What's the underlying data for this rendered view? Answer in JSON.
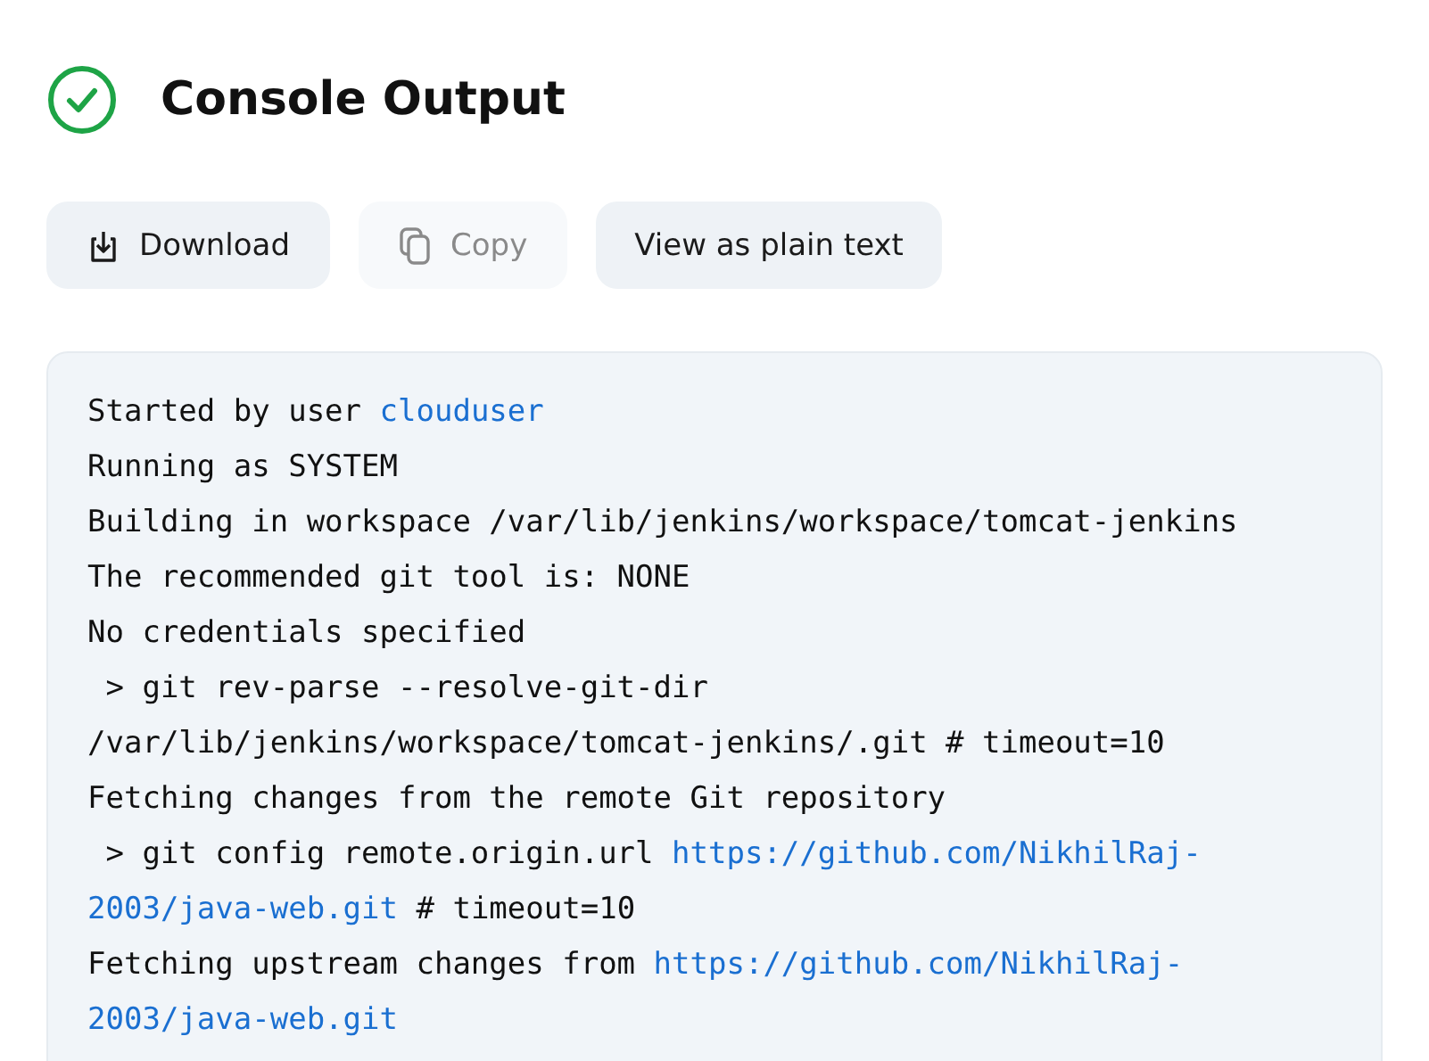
{
  "header": {
    "title": "Console Output",
    "succeeded": true
  },
  "buttons": [
    {
      "label": "Download",
      "kind": "download",
      "disabled": false
    },
    {
      "label": "Copy",
      "kind": "copy",
      "disabled": true
    },
    {
      "label": "View as plain text",
      "kind": "plain",
      "disabled": false
    }
  ],
  "console": {
    "lines": [
      [
        {
          "kind": "text",
          "text": "Started by user "
        },
        {
          "kind": "link",
          "text": "clouduser"
        }
      ],
      [
        {
          "kind": "text",
          "text": "Running as SYSTEM"
        }
      ],
      [
        {
          "kind": "text",
          "text": "Building in workspace /var/lib/jenkins/workspace/tomcat-jenkins"
        }
      ],
      [
        {
          "kind": "text",
          "text": "The recommended git tool is: NONE"
        }
      ],
      [
        {
          "kind": "text",
          "text": "No credentials specified"
        }
      ],
      [
        {
          "kind": "text",
          "text": " > git rev-parse --resolve-git-dir"
        }
      ],
      [
        {
          "kind": "text",
          "text": "/var/lib/jenkins/workspace/tomcat-jenkins/.git # timeout=10"
        }
      ],
      [
        {
          "kind": "text",
          "text": "Fetching changes from the remote Git repository"
        }
      ],
      [
        {
          "kind": "text",
          "text": " > git config remote.origin.url "
        },
        {
          "kind": "link",
          "text": "https://github.com/NikhilRaj-"
        }
      ],
      [
        {
          "kind": "link",
          "text": "2003/java-web.git"
        },
        {
          "kind": "text",
          "text": " # timeout=10"
        }
      ],
      [
        {
          "kind": "text",
          "text": "Fetching upstream changes from "
        },
        {
          "kind": "link",
          "text": "https://github.com/NikhilRaj-"
        }
      ],
      [
        {
          "kind": "link",
          "text": "2003/java-web.git"
        }
      ]
    ]
  }
}
